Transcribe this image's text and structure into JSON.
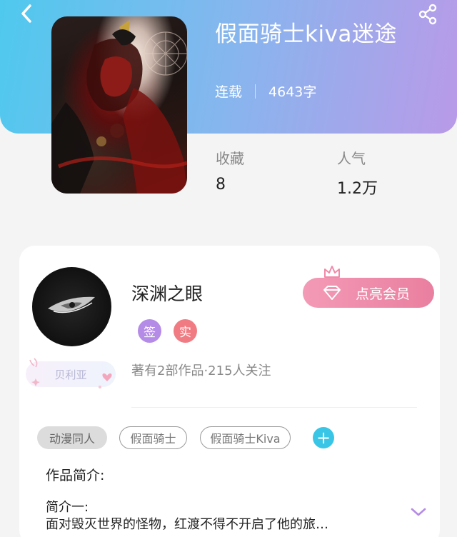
{
  "header": {
    "title": "假面骑士kiva迷途",
    "status": "连载",
    "word_count": "4643字"
  },
  "stats": {
    "favorites_label": "收藏",
    "favorites_value": "8",
    "popularity_label": "人气",
    "popularity_value": "1.2万"
  },
  "author": {
    "name": "深渊之眼",
    "badges": [
      "签",
      "实"
    ],
    "fan_tag": "贝利亚",
    "meta": "著有2部作品·215人关注",
    "member_button": "点亮会员"
  },
  "tags": [
    "动漫同人",
    "假面骑士",
    "假面骑士Kiva"
  ],
  "add_tag": "+",
  "intro": {
    "heading": "作品简介:",
    "line1": "简介一:",
    "line2": "面对毁灭世界的怪物，红渡不得不开启了他的旅…"
  },
  "colors": {
    "header_gradient_start": "#4fc9ee",
    "header_gradient_end": "#b99ae8",
    "badge_sign": "#b48be6",
    "badge_real": "#f07b82",
    "member_pink": "#ea7fa0",
    "add_button": "#39c6e6"
  },
  "icons": {
    "back": "chevron-left-icon",
    "share": "share-icon",
    "crown": "crown-icon",
    "diamond": "diamond-icon",
    "expand": "chevron-down-icon"
  }
}
